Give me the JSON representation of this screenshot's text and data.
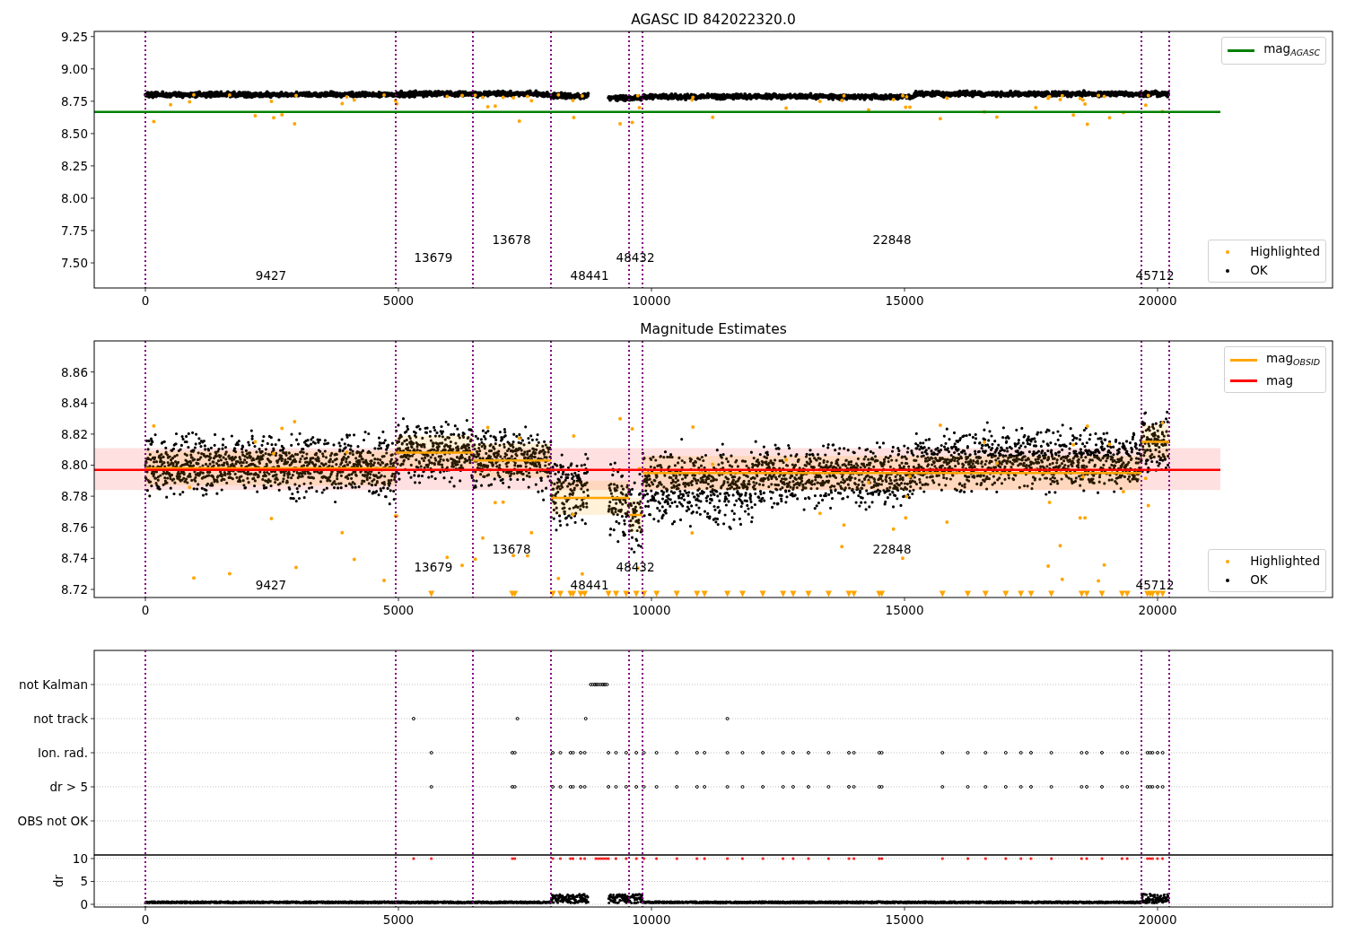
{
  "figure": {
    "panels": [
      {
        "kind": "mag",
        "chart_data": {
          "type": "line",
          "title": "AGASC ID 842022320.0",
          "xlim": [
            -1011,
            23457
          ],
          "ylim": [
            7.306,
            9.29
          ],
          "x": [
            -1011,
            21240
          ],
          "xticks": [
            {
              "value": 0,
              "label": "0"
            },
            {
              "value": 5000,
              "label": "5000"
            },
            {
              "value": 10000,
              "label": "10000"
            },
            {
              "value": 15000,
              "label": "15000"
            },
            {
              "value": 20000,
              "label": "20000"
            }
          ],
          "yticks": [
            {
              "value": 7.5,
              "label": "7.50"
            },
            {
              "value": 7.75,
              "label": "7.75"
            },
            {
              "value": 8.0,
              "label": "8.00"
            },
            {
              "value": 8.25,
              "label": "8.25"
            },
            {
              "value": 8.5,
              "label": "8.50"
            },
            {
              "value": 8.75,
              "label": "8.75"
            },
            {
              "value": 9.0,
              "label": "9.00"
            },
            {
              "value": 9.25,
              "label": "9.25"
            }
          ],
          "series": [
            {
              "name": "mag$_{AGASC}$",
              "color": "#008000",
              "values": [
                8.667,
                8.667
              ]
            }
          ]
        },
        "points_legend": [
          {
            "label": "Highlighted",
            "color": "#ffa500"
          },
          {
            "label": "OK",
            "color": "#000000"
          }
        ],
        "obsid_labels": [
          "9427",
          "13679",
          "13678",
          "48441",
          "48432",
          "22848",
          "45712"
        ]
      },
      {
        "kind": "estimates",
        "chart_data": {
          "type": "line",
          "title": "Magnitude Estimates",
          "xlim": [
            -1011,
            23457
          ],
          "ylim": [
            8.7148,
            8.88
          ],
          "x": [
            -1011,
            0,
            4947,
            4947,
            4947,
            6472,
            6472,
            6472,
            8014,
            8014,
            8014,
            9557,
            9557,
            9557,
            9823,
            9823,
            9823,
            19681,
            19681,
            19681,
            20230,
            21240
          ],
          "xticks": [
            {
              "value": 0,
              "label": "0"
            },
            {
              "value": 5000,
              "label": "5000"
            },
            {
              "value": 10000,
              "label": "10000"
            },
            {
              "value": 15000,
              "label": "15000"
            },
            {
              "value": 20000,
              "label": "20000"
            }
          ],
          "yticks": [
            {
              "value": 8.72,
              "label": "8.72"
            },
            {
              "value": 8.74,
              "label": "8.74"
            },
            {
              "value": 8.76,
              "label": "8.76"
            },
            {
              "value": 8.78,
              "label": "8.78"
            },
            {
              "value": 8.8,
              "label": "8.80"
            },
            {
              "value": 8.82,
              "label": "8.82"
            },
            {
              "value": 8.84,
              "label": "8.84"
            },
            {
              "value": 8.86,
              "label": "8.86"
            }
          ],
          "series": [
            {
              "name": "mag$_{OBSID}$",
              "color": "#ffa500",
              "values": [
                null,
                8.798,
                8.798,
                null,
                8.808,
                8.808,
                null,
                8.803,
                8.803,
                null,
                8.779,
                8.779,
                null,
                8.768,
                8.768,
                null,
                8.795,
                8.795,
                null,
                8.815,
                8.815,
                null
              ]
            },
            {
              "name": "mag",
              "color": "#ff0000",
              "values": [
                8.797,
                8.797,
                8.797,
                8.797,
                8.797,
                8.797,
                8.797,
                8.797,
                8.797,
                8.797,
                8.797,
                8.797,
                8.797,
                8.797,
                8.797,
                8.797,
                8.797,
                8.797,
                8.797,
                8.797,
                8.797,
                8.797
              ]
            }
          ]
        },
        "points_legend": [
          {
            "label": "Highlighted",
            "color": "#ffa500"
          },
          {
            "label": "OK",
            "color": "#000000"
          }
        ],
        "obsid_labels": [
          "9427",
          "13679",
          "13678",
          "48441",
          "48432",
          "22848",
          "45712"
        ]
      },
      {
        "kind": "flags",
        "categories": [
          "not Kalman",
          "not track",
          "Ion. rad.",
          "dr > 5",
          "OBS not OK"
        ],
        "chart_data": {
          "type": "scatter",
          "ylabel": "dr",
          "grid": true,
          "xlim": [
            -1011,
            23457
          ],
          "ylim": [
            -0.59,
            10.78
          ],
          "xticks": [
            {
              "value": 0,
              "label": "0"
            },
            {
              "value": 5000,
              "label": "5000"
            },
            {
              "value": 10000,
              "label": "10000"
            },
            {
              "value": 15000,
              "label": "15000"
            },
            {
              "value": 20000,
              "label": "20000"
            }
          ],
          "yticks": [
            {
              "value": 0,
              "label": "0"
            },
            {
              "value": 5,
              "label": "5"
            },
            {
              "value": 10,
              "label": "10"
            }
          ]
        }
      }
    ]
  }
}
